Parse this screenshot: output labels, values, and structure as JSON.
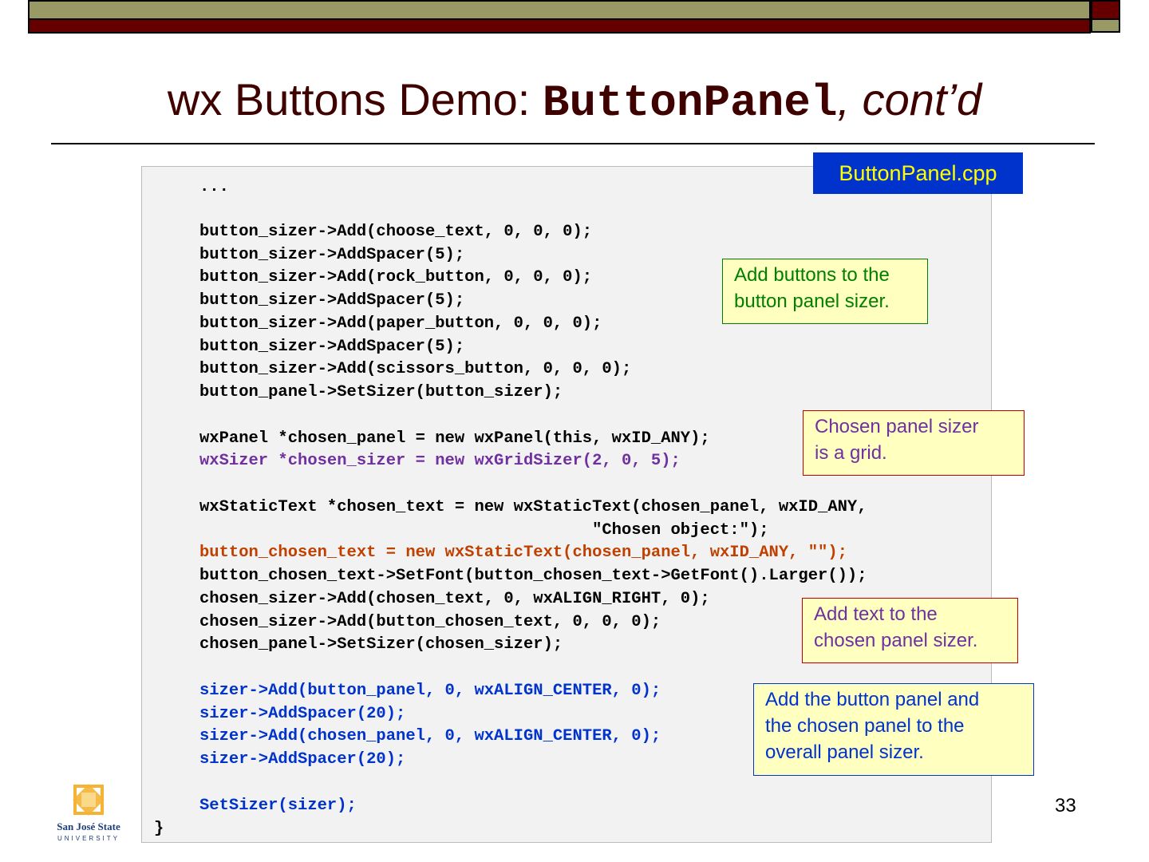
{
  "slide": {
    "title_prefix": "wx Buttons Demo: ",
    "title_code": "ButtonPanel",
    "title_suffix": ", cont’d",
    "filename": "ButtonPanel.cpp",
    "page_number": "33",
    "logo_text": "San José State UNIVERSITY"
  },
  "colors": {
    "black": "#000000",
    "purple": "#7030a0",
    "orange": "#c04000",
    "blue": "#0033cc",
    "green": "#008000"
  },
  "code_lines": [
    {
      "text": "...",
      "color": "#000000",
      "indent": true
    },
    {
      "text": "button_sizer->Add(choose_text, 0, 0, 0);",
      "color": "#000000",
      "indent": true
    },
    {
      "text": "button_sizer->AddSpacer(5);",
      "color": "#000000",
      "indent": true
    },
    {
      "text": "button_sizer->Add(rock_button, 0, 0, 0);",
      "color": "#000000",
      "indent": true
    },
    {
      "text": "button_sizer->AddSpacer(5);",
      "color": "#000000",
      "indent": true
    },
    {
      "text": "button_sizer->Add(paper_button, 0, 0, 0);",
      "color": "#000000",
      "indent": true
    },
    {
      "text": "button_sizer->AddSpacer(5);",
      "color": "#000000",
      "indent": true
    },
    {
      "text": "button_sizer->Add(scissors_button, 0, 0, 0);",
      "color": "#000000",
      "indent": true
    },
    {
      "text": "button_panel->SetSizer(button_sizer);",
      "color": "#000000",
      "indent": true
    },
    {
      "text": "wxPanel *chosen_panel = new wxPanel(this, wxID_ANY);",
      "color": "#000000",
      "indent": true
    },
    {
      "text": "wxSizer *chosen_sizer = new wxGridSizer(2, 0, 5);",
      "color": "#7030a0",
      "indent": true
    },
    {
      "text": "wxStaticText *chosen_text = new wxStaticText(chosen_panel, wxID_ANY,",
      "color": "#000000",
      "indent": true
    },
    {
      "text": "                                        \"Chosen object:\");",
      "color": "#000000",
      "indent": true
    },
    {
      "text": "button_chosen_text = new wxStaticText(chosen_panel, wxID_ANY, \"\");",
      "color": "#c04000",
      "indent": true
    },
    {
      "text": "button_chosen_text->SetFont(button_chosen_text->GetFont().Larger());",
      "color": "#000000",
      "indent": true
    },
    {
      "text": "chosen_sizer->Add(chosen_text, 0, wxALIGN_RIGHT, 0);",
      "color": "#000000",
      "indent": true
    },
    {
      "text": "chosen_sizer->Add(button_chosen_text, 0, 0, 0);",
      "color": "#000000",
      "indent": true
    },
    {
      "text": "chosen_panel->SetSizer(chosen_sizer);",
      "color": "#000000",
      "indent": true
    },
    {
      "text": "sizer->Add(button_panel, 0, wxALIGN_CENTER, 0);",
      "color": "#0033cc",
      "indent": true
    },
    {
      "text": "sizer->AddSpacer(20);",
      "color": "#0033cc",
      "indent": true
    },
    {
      "text": "sizer->Add(chosen_panel, 0, wxALIGN_CENTER, 0);",
      "color": "#0033cc",
      "indent": true
    },
    {
      "text": "sizer->AddSpacer(20);",
      "color": "#0033cc",
      "indent": true
    },
    {
      "text": "SetSizer(sizer);",
      "color": "#0033cc",
      "indent": true
    },
    {
      "text": "}",
      "color": "#000000",
      "indent": false
    }
  ],
  "notes": [
    {
      "lines": [
        "Add buttons to the",
        "button panel sizer."
      ],
      "color": "#008000"
    },
    {
      "lines": [
        "Chosen panel sizer",
        "is a grid."
      ],
      "color": "#7030a0"
    },
    {
      "lines": [
        "Add text to the",
        "chosen panel sizer."
      ],
      "color": "#7030a0"
    },
    {
      "lines": [
        "Add the button panel and",
        "the chosen panel to the",
        "overall panel sizer."
      ],
      "color": "#0033cc"
    }
  ]
}
